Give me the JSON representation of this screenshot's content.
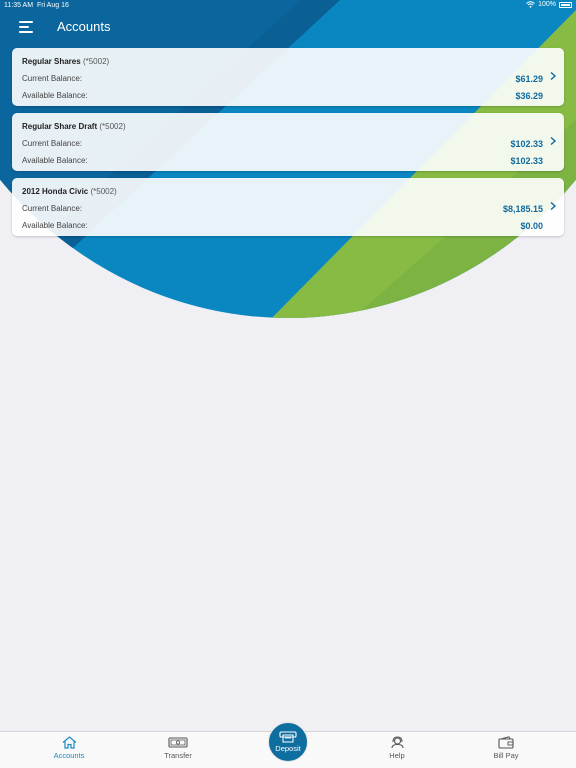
{
  "status_bar": {
    "time": "11:35 AM",
    "date": "Fri Aug 16",
    "battery": "100%"
  },
  "navbar": {
    "title": "Accounts"
  },
  "accounts": [
    {
      "name": "Regular Shares",
      "number": "(*5002)",
      "current_label": "Current Balance:",
      "current_value": "$61.29",
      "available_label": "Available Balance:",
      "available_value": "$36.29"
    },
    {
      "name": "Regular Share Draft",
      "number": "(*5002)",
      "current_label": "Current Balance:",
      "current_value": "$102.33",
      "available_label": "Available Balance:",
      "available_value": "$102.33"
    },
    {
      "name": "2012 Honda Civic",
      "number": "(*5002)",
      "current_label": "Current Balance:",
      "current_value": "$8,185.15",
      "available_label": "Available Balance:",
      "available_value": "$0.00"
    }
  ],
  "tabs": {
    "accounts": "Accounts",
    "transfer": "Transfer",
    "deposit": "Deposit",
    "help": "Help",
    "bill_pay": "Bill Pay"
  },
  "icons": {
    "menu": "hamburger-icon",
    "chevron": "chevron-right-icon",
    "accounts": "home-icon",
    "transfer": "cash-icon",
    "deposit": "atm-icon",
    "help": "headset-icon",
    "bill_pay": "wallet-icon"
  },
  "colors": {
    "header_blue": "#0a86c1",
    "header_dark_blue": "#0a5f95",
    "header_green": "#7cb342",
    "accent": "#1a8ac4",
    "amount": "#106a9e",
    "deposit_button": "#0f6ea0"
  }
}
